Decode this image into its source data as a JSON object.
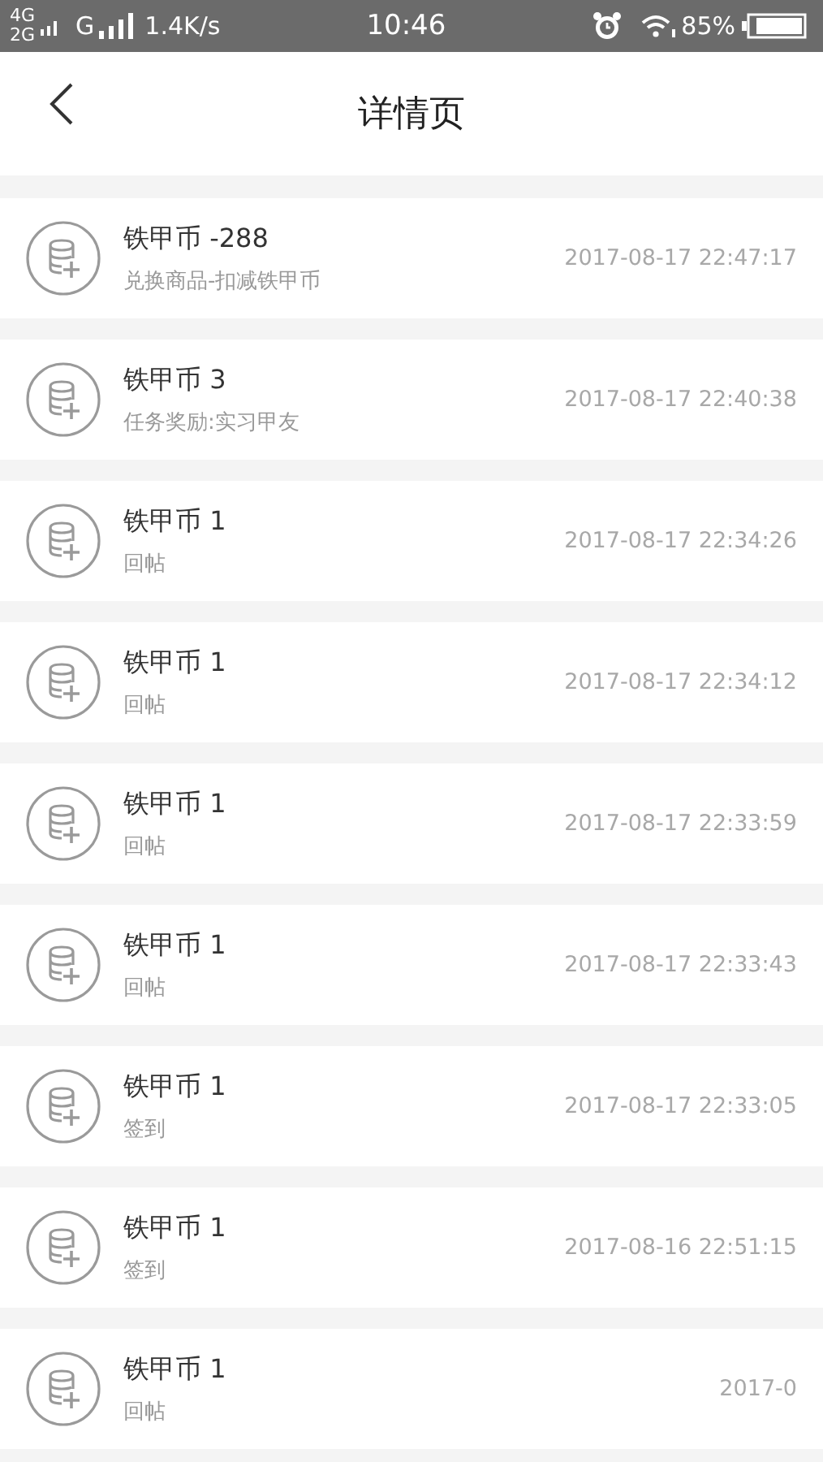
{
  "status_bar": {
    "network_top": "4G",
    "network_bottom": "2G",
    "network_second": "G",
    "speed": "1.4K/s",
    "time": "10:46",
    "battery": "85%"
  },
  "header": {
    "title": "详情页"
  },
  "records": [
    {
      "title": "铁甲币 -288",
      "subtitle": "兑换商品-扣减铁甲币",
      "time": "2017-08-17 22:47:17"
    },
    {
      "title": "铁甲币 3",
      "subtitle": "任务奖励:实习甲友",
      "time": "2017-08-17 22:40:38"
    },
    {
      "title": "铁甲币 1",
      "subtitle": "回帖",
      "time": "2017-08-17 22:34:26"
    },
    {
      "title": "铁甲币 1",
      "subtitle": "回帖",
      "time": "2017-08-17 22:34:12"
    },
    {
      "title": "铁甲币 1",
      "subtitle": "回帖",
      "time": "2017-08-17 22:33:59"
    },
    {
      "title": "铁甲币 1",
      "subtitle": "回帖",
      "time": "2017-08-17 22:33:43"
    },
    {
      "title": "铁甲币 1",
      "subtitle": "签到",
      "time": "2017-08-17 22:33:05"
    },
    {
      "title": "铁甲币 1",
      "subtitle": "签到",
      "time": "2017-08-16 22:51:15"
    },
    {
      "title": "铁甲币 1",
      "subtitle": "回帖",
      "time": "2017-0"
    }
  ]
}
